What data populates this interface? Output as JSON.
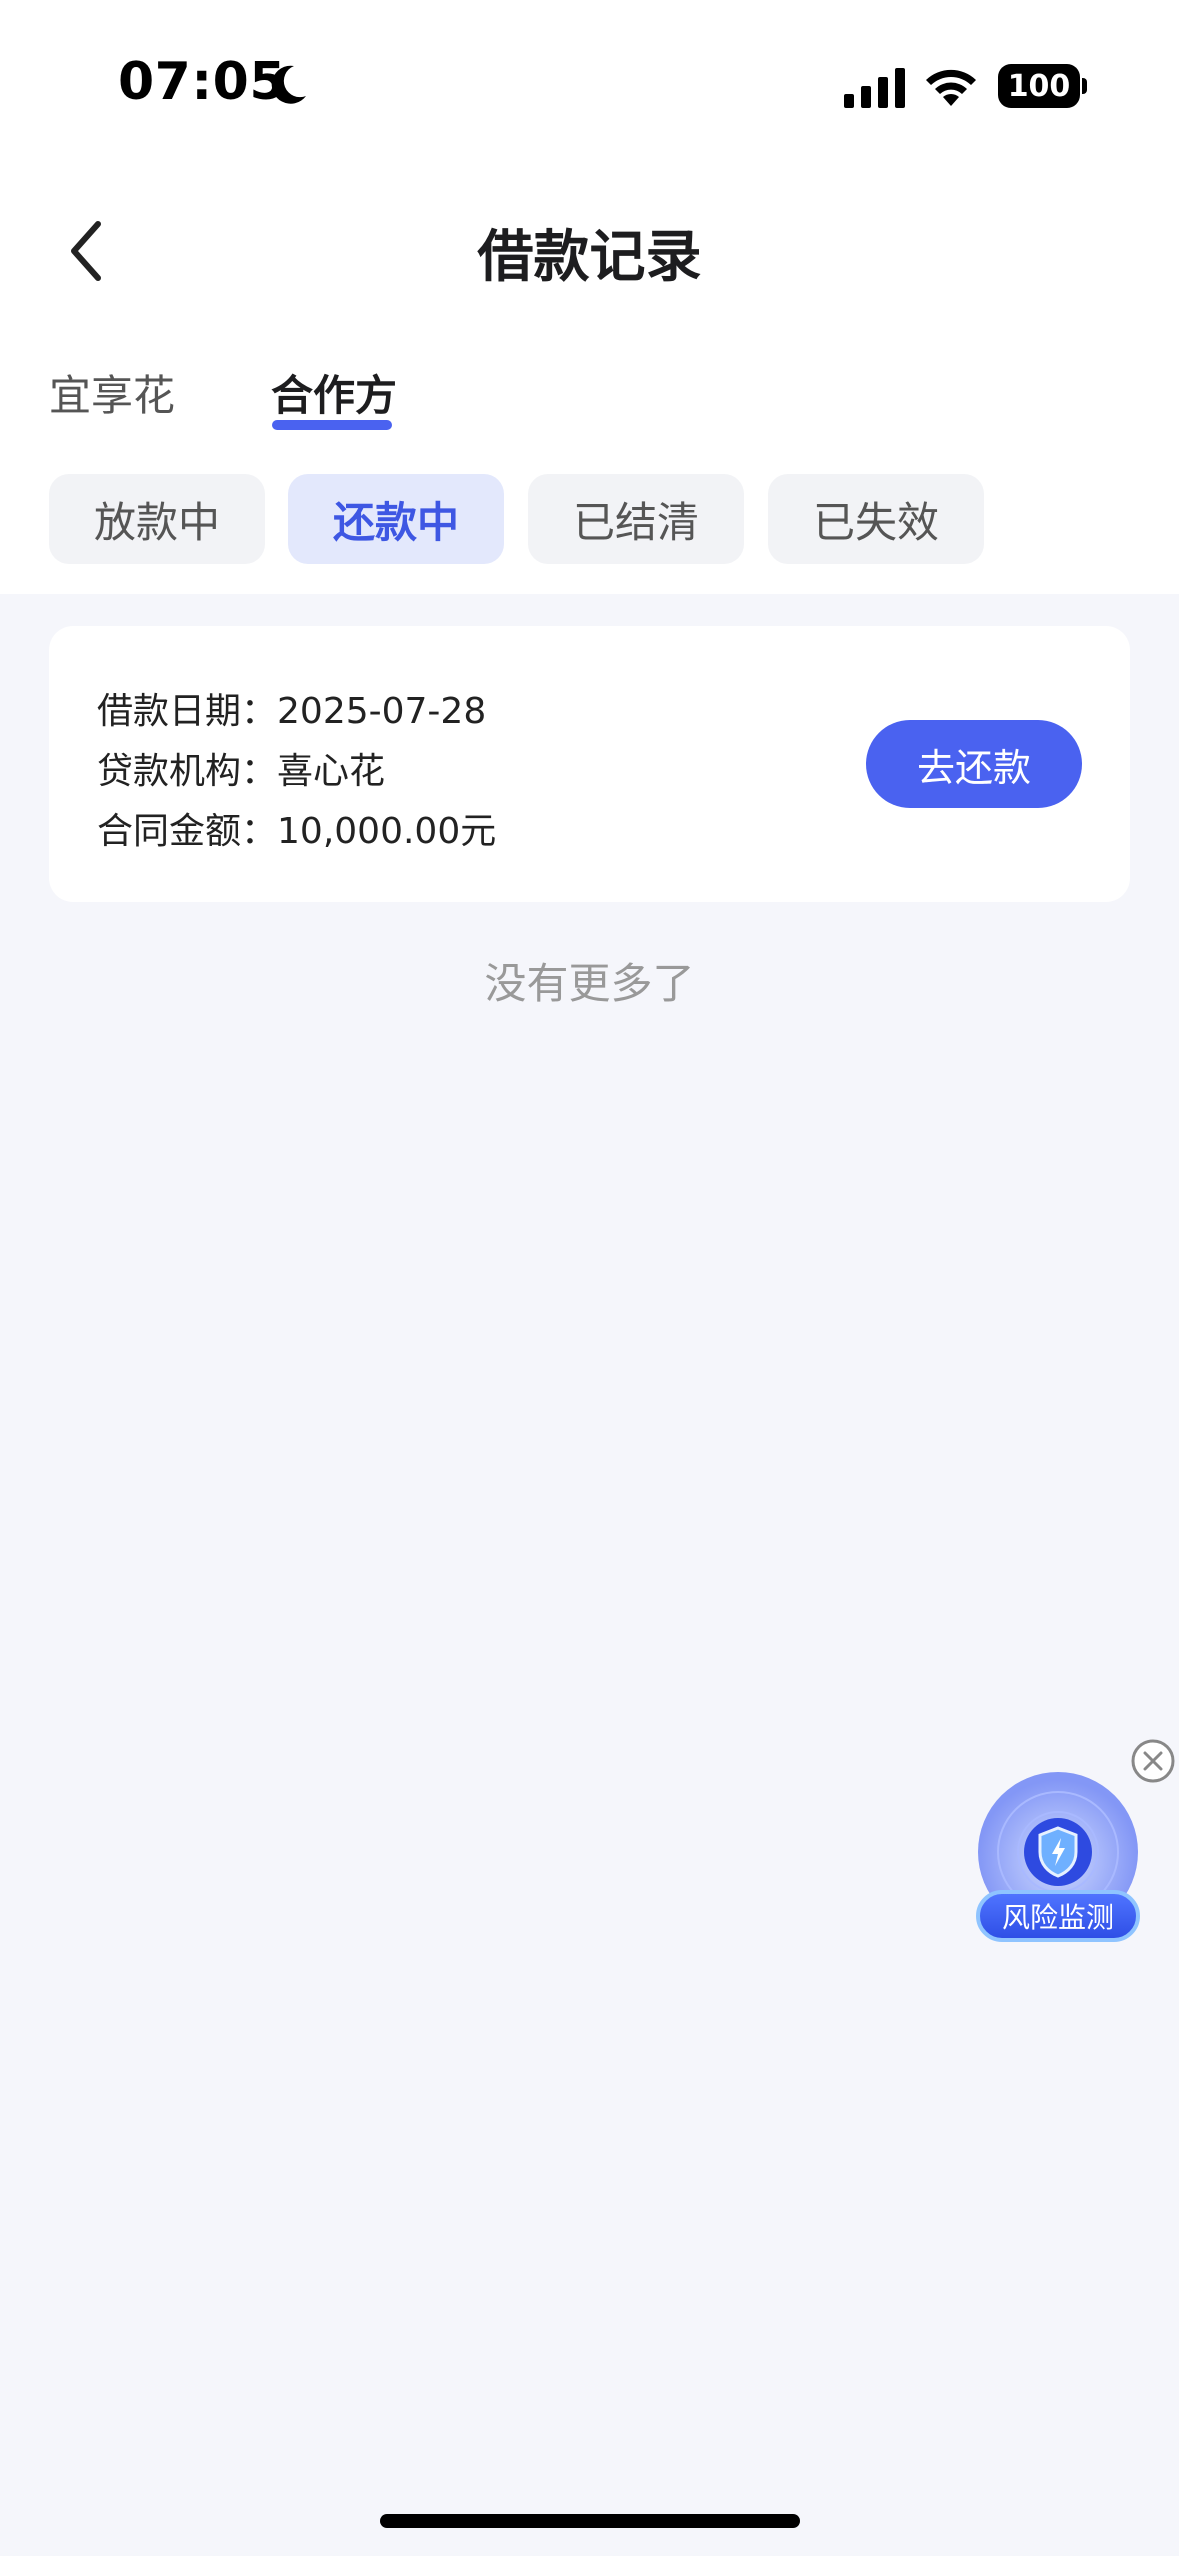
{
  "status_bar": {
    "time": "07:05",
    "battery": "100"
  },
  "header": {
    "title": "借款记录"
  },
  "provider_tabs": [
    {
      "label": "宜享花"
    },
    {
      "label": "合作方"
    }
  ],
  "filter_chips": [
    {
      "label": "放款中"
    },
    {
      "label": "还款中"
    },
    {
      "label": "已结清"
    },
    {
      "label": "已失效"
    }
  ],
  "loan": {
    "date_label": "借款日期：",
    "date_value": "2025-07-28",
    "lender_label": "贷款机构：",
    "lender_value": "喜心花",
    "amount_label": "合同金额：",
    "amount_value": "10,000.00元",
    "repay_button": "去还款"
  },
  "list_end_text": "没有更多了",
  "risk_widget": {
    "label": "风险监测"
  },
  "colors": {
    "accent": "#4a62f0",
    "active_chip_bg": "#e3e8fc",
    "page_bg": "#f5f6fb"
  }
}
